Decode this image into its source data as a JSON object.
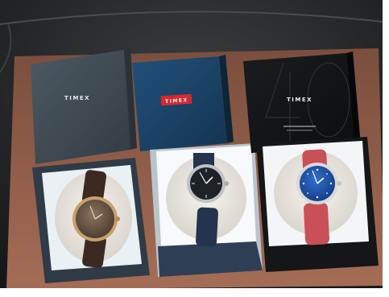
{
  "photo": {
    "boxes": [
      {
        "id": "left",
        "lid_brand": "TIMEX",
        "lid_color": "#3f4b53",
        "watch_dial": "#6b5a4a",
        "watch_case": "#c7a06a",
        "watch_strap": "#3a2a22"
      },
      {
        "id": "center",
        "lid_brand": "TIMEX",
        "lid_color": "#1b4060",
        "brand_badge_color": "#d8272e",
        "watch_dial": "#1d2228",
        "watch_case": "#bfc3c6",
        "watch_strap": "#24344f"
      },
      {
        "id": "right",
        "lid_brand": "TIMEX",
        "lid_color": "#111315",
        "watch_dial": "#1d4fa2",
        "watch_case": "#d7d9db",
        "watch_strap": "#c85056"
      }
    ],
    "colors": {
      "car_seat": "#2a2c2f",
      "leather_panel": "#8b5a46",
      "cushion": "#ece8e2"
    }
  }
}
